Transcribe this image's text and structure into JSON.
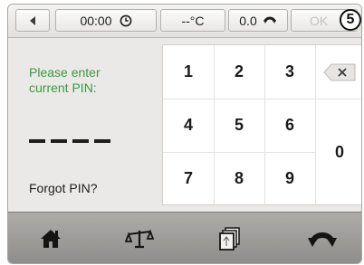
{
  "status_bar": {
    "time": "00:00",
    "temperature": "--°C",
    "speed": "0.0",
    "ok_label": "OK",
    "callout_number": "5"
  },
  "pin_panel": {
    "prompt": "Please enter\ncurrent PIN:",
    "entered_digits": 0,
    "pin_length": 4,
    "forgot_label": "Forgot PIN?"
  },
  "keypad": {
    "keys": [
      "1",
      "2",
      "3",
      "4",
      "5",
      "6",
      "7",
      "8",
      "9",
      "0"
    ]
  },
  "bottom_nav": {
    "items": [
      "home-icon",
      "balance-scale-icon",
      "document-stack-icon",
      "rotation-icon"
    ]
  },
  "colors": {
    "prompt_green": "#3a9a3e",
    "disabled_text": "#c3c1bd"
  }
}
